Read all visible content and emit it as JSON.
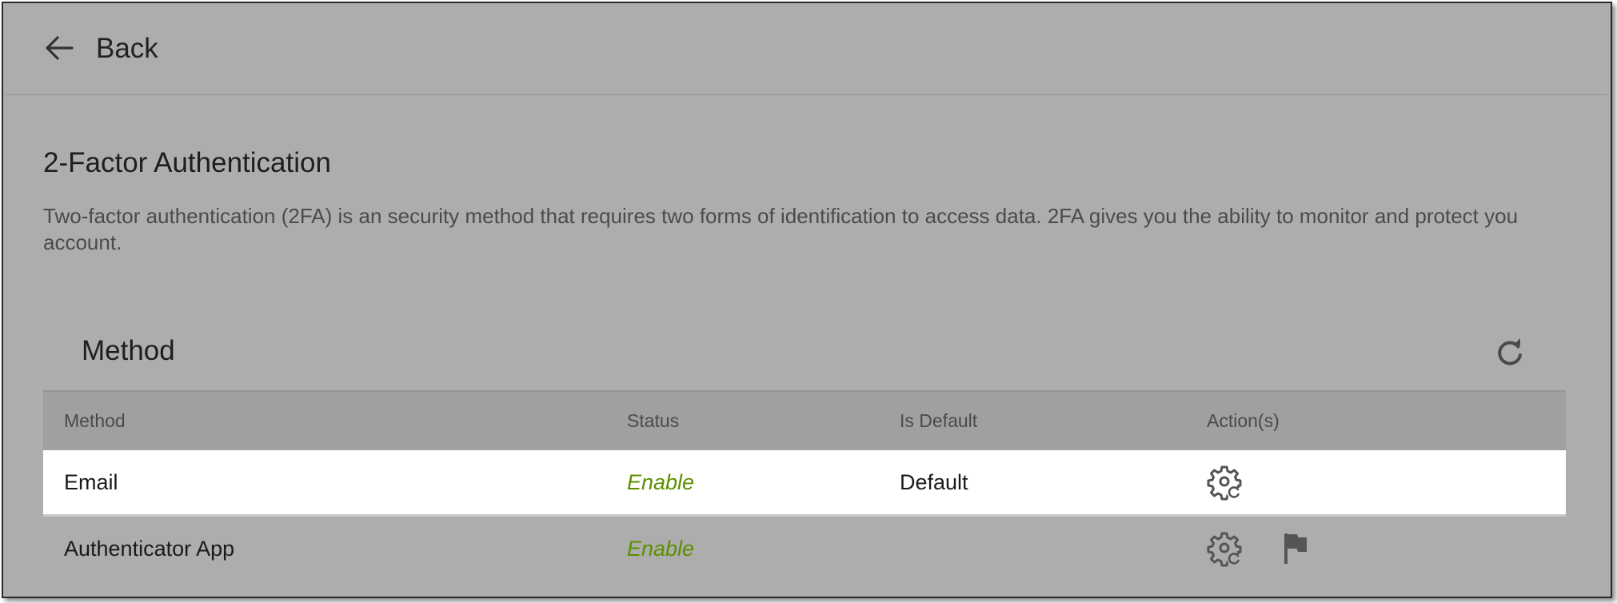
{
  "header": {
    "back_label": "Back"
  },
  "page": {
    "title": "2-Factor Authentication",
    "description": "Two-factor authentication (2FA) is an security method that requires two forms of identification to access data. 2FA gives you the ability to monitor and protect you account."
  },
  "methods": {
    "section_title": "Method",
    "columns": [
      "Method",
      "Status",
      "Is Default",
      "Action(s)"
    ],
    "rows": [
      {
        "method": "Email",
        "status": "Enable",
        "is_default": "Default",
        "actions": [
          "settings-refresh-icon"
        ]
      },
      {
        "method": "Authenticator App",
        "status": "Enable",
        "is_default": "",
        "actions": [
          "settings-refresh-icon",
          "flag-icon"
        ]
      }
    ]
  },
  "colors": {
    "background": "#adadad",
    "status_enabled": "#5c8f00",
    "highlight_row": "#ffffff",
    "header_row": "#a0a0a0"
  }
}
